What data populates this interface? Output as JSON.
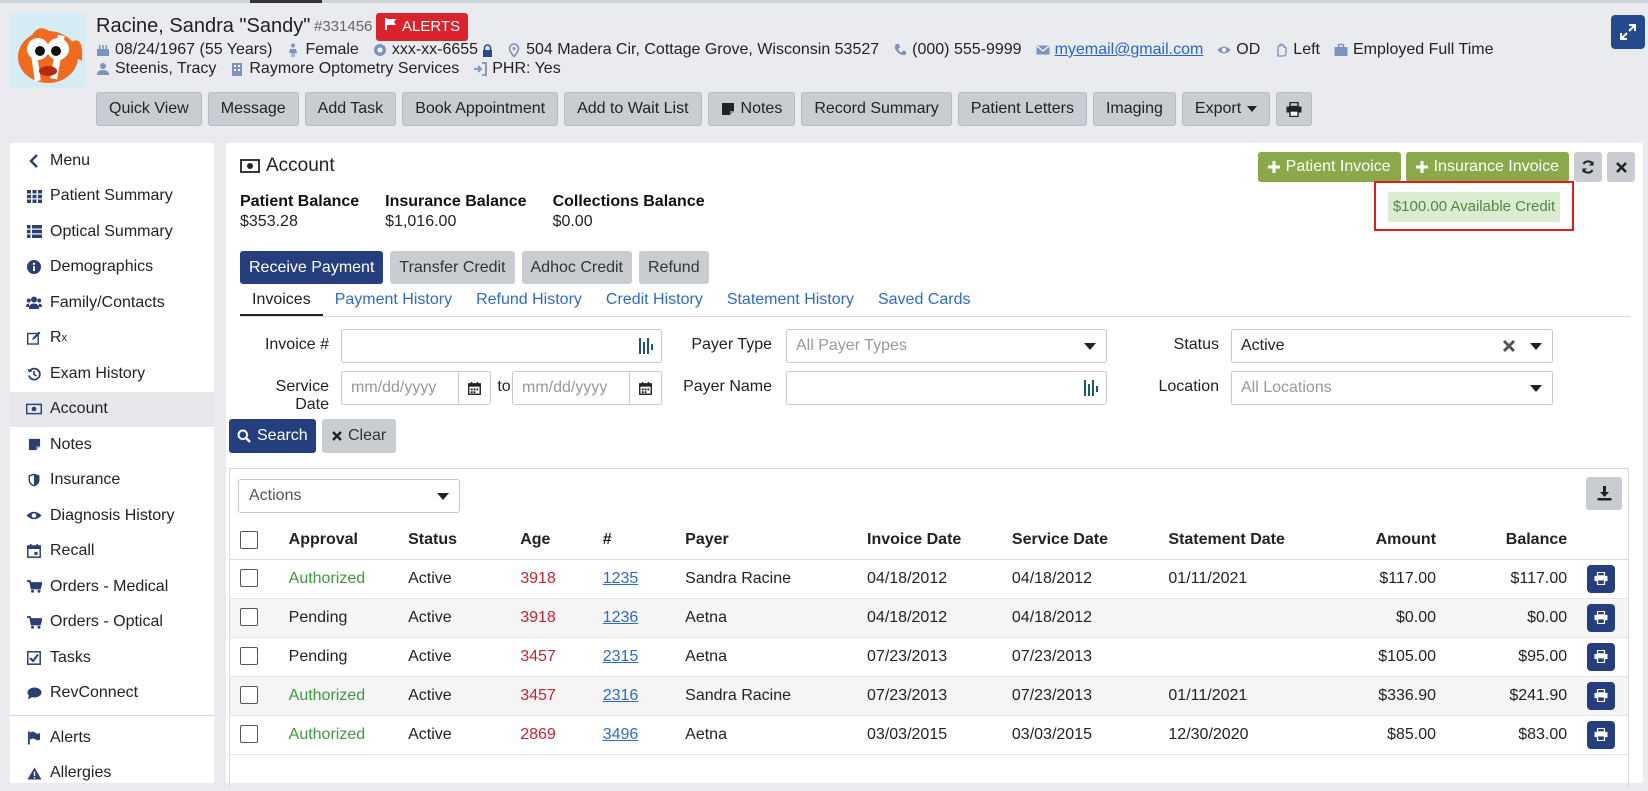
{
  "patient": {
    "name": "Racine, Sandra \"Sandy\"",
    "id": "#331456",
    "alerts_label": "ALERTS",
    "dob": "08/24/1967 (55 Years)",
    "gender": "Female",
    "ssn": "xxx-xx-6655",
    "address": "504 Madera Cir, Cottage Grove, Wisconsin 53527",
    "phone": "(000) 555-9999",
    "email": "myemail@gmail.com",
    "eye": "OD",
    "hand": "Left",
    "employment": "Employed Full Time",
    "provider": "Steenis, Tracy",
    "location": "Raymore Optometry Services",
    "phr": "PHR: Yes"
  },
  "toolbar": {
    "buttons": [
      "Quick View",
      "Message",
      "Add Task",
      "Book Appointment",
      "Add to Wait List",
      "Notes",
      "Record Summary",
      "Patient Letters",
      "Imaging",
      "Export"
    ]
  },
  "sidebar": {
    "items": [
      {
        "label": "Menu",
        "icon": "chevron-left-icon"
      },
      {
        "label": "Patient Summary",
        "icon": "grid-icon"
      },
      {
        "label": "Optical Summary",
        "icon": "list-icon"
      },
      {
        "label": "Demographics",
        "icon": "info-icon"
      },
      {
        "label": "Family/Contacts",
        "icon": "users-icon"
      },
      {
        "label": "R",
        "sub": "x",
        "icon": "edit-icon"
      },
      {
        "label": "Exam History",
        "icon": "history-icon"
      },
      {
        "label": "Account",
        "icon": "money-icon",
        "active": true
      },
      {
        "label": "Notes",
        "icon": "note-icon"
      },
      {
        "label": "Insurance",
        "icon": "shield-icon"
      },
      {
        "label": "Diagnosis History",
        "icon": "eye-icon"
      },
      {
        "label": "Recall",
        "icon": "calendar-icon"
      },
      {
        "label": "Orders - Medical",
        "icon": "cart-icon"
      },
      {
        "label": "Orders - Optical",
        "icon": "cart-icon"
      },
      {
        "label": "Tasks",
        "icon": "check-icon"
      },
      {
        "label": "RevConnect",
        "icon": "chat-icon"
      },
      {
        "label": "Alerts",
        "icon": "flag-icon"
      },
      {
        "label": "Allergies",
        "icon": "warning-icon"
      }
    ]
  },
  "account": {
    "title": "Account",
    "patient_invoice_label": "Patient Invoice",
    "insurance_invoice_label": "Insurance Invoice",
    "available_credit": "$100.00 Available Credit",
    "balances": [
      {
        "label": "Patient Balance",
        "value": "$353.28"
      },
      {
        "label": "Insurance Balance",
        "value": "$1,016.00"
      },
      {
        "label": "Collections Balance",
        "value": "$0.00"
      }
    ],
    "pay_buttons": [
      "Receive Payment",
      "Transfer Credit",
      "Adhoc Credit",
      "Refund"
    ],
    "tabs": [
      "Invoices",
      "Payment History",
      "Refund History",
      "Credit History",
      "Statement History",
      "Saved Cards"
    ]
  },
  "filters": {
    "invoice_label": "Invoice #",
    "service_date_label": "Service Date",
    "date_placeholder": "mm/dd/yyyy",
    "to_label": "to",
    "payer_type_label": "Payer Type",
    "payer_type_placeholder": "All Payer Types",
    "payer_name_label": "Payer Name",
    "status_label": "Status",
    "status_value": "Active",
    "location_label": "Location",
    "location_placeholder": "All Locations",
    "search_label": "Search",
    "clear_label": "Clear"
  },
  "table": {
    "actions_label": "Actions",
    "columns": [
      "Approval",
      "Status",
      "Age",
      "#",
      "Payer",
      "Invoice Date",
      "Service Date",
      "Statement Date",
      "Amount",
      "Balance"
    ],
    "rows": [
      {
        "approval": "Authorized",
        "status": "Active",
        "age": "3918",
        "num": "1235",
        "payer": "Sandra Racine",
        "invoice_date": "04/18/2012",
        "service_date": "04/18/2012",
        "statement_date": "01/11/2021",
        "amount": "$117.00",
        "balance": "$117.00"
      },
      {
        "approval": "Pending",
        "status": "Active",
        "age": "3918",
        "num": "1236",
        "payer": "Aetna",
        "invoice_date": "04/18/2012",
        "service_date": "04/18/2012",
        "statement_date": "",
        "amount": "$0.00",
        "balance": "$0.00"
      },
      {
        "approval": "Pending",
        "status": "Active",
        "age": "3457",
        "num": "2315",
        "payer": "Aetna",
        "invoice_date": "07/23/2013",
        "service_date": "07/23/2013",
        "statement_date": "",
        "amount": "$105.00",
        "balance": "$95.00"
      },
      {
        "approval": "Authorized",
        "status": "Active",
        "age": "3457",
        "num": "2316",
        "payer": "Sandra Racine",
        "invoice_date": "07/23/2013",
        "service_date": "07/23/2013",
        "statement_date": "01/11/2021",
        "amount": "$336.90",
        "balance": "$241.90"
      },
      {
        "approval": "Authorized",
        "status": "Active",
        "age": "2869",
        "num": "3496",
        "payer": "Aetna",
        "invoice_date": "03/03/2015",
        "service_date": "03/03/2015",
        "statement_date": "12/30/2020",
        "amount": "$85.00",
        "balance": "$83.00"
      }
    ]
  }
}
